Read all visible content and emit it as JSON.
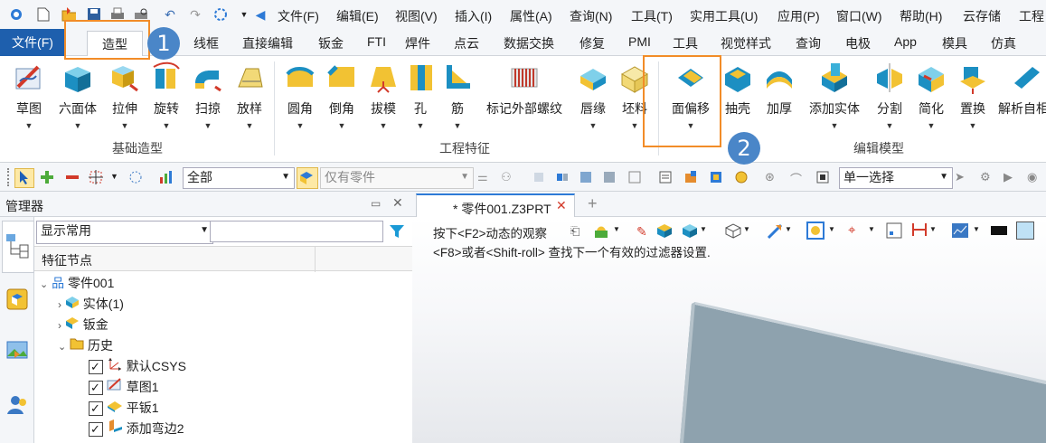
{
  "menu": {
    "items": [
      "文件(F)",
      "编辑(E)",
      "视图(V)",
      "插入(I)",
      "属性(A)",
      "查询(N)",
      "工具(T)",
      "实用工具(U)",
      "应用(P)",
      "窗口(W)",
      "帮助(H)",
      "云存储",
      "工程"
    ]
  },
  "tabs": {
    "file": "文件(F)",
    "active": "造型",
    "items": [
      "线框",
      "直接编辑",
      "钣金",
      "FTI",
      "焊件",
      "点云",
      "数据交换",
      "修复",
      "PMI",
      "工具",
      "视觉样式",
      "查询",
      "电极",
      "App",
      "模具",
      "仿真"
    ]
  },
  "ribbon": {
    "groups": {
      "basic": "基础造型",
      "eng": "工程特征",
      "edit": "编辑模型"
    },
    "buttons": [
      "草图",
      "六面体",
      "拉伸",
      "旋转",
      "扫掠",
      "放样",
      "圆角",
      "倒角",
      "拔模",
      "孔",
      "筋",
      "标记外部螺纹",
      "唇缘",
      "坯料",
      "面偏移",
      "抽壳",
      "加厚",
      "添加实体",
      "分割",
      "简化",
      "置换",
      "解析自相"
    ]
  },
  "toolbar": {
    "filter_all": "全部",
    "only_parts": "仅有零件",
    "select_mode": "单一选择"
  },
  "manager": {
    "title": "管理器",
    "filter_combo": "显示常用",
    "column_header": "特征节点",
    "tree": {
      "root": "零件001",
      "solid": "实体(1)",
      "sheetmetal": "钣金",
      "history": "历史",
      "csys": "默认CSYS",
      "sketch": "草图1",
      "flat": "平钣1",
      "flange": "添加弯边2"
    }
  },
  "document": {
    "tab_label": "* 零件001.Z3PRT",
    "hint_line1": "按下<F2>动态的观察",
    "hint_line2": "<F8>或者<Shift-roll> 查找下一个有效的过滤器设置."
  },
  "annotations": {
    "badge1": "1",
    "badge2": "2"
  },
  "colors": {
    "accent": "#1e5fad",
    "highlight": "#f28c28",
    "badge": "#4a86c8",
    "plate": "#8ea2ae"
  }
}
